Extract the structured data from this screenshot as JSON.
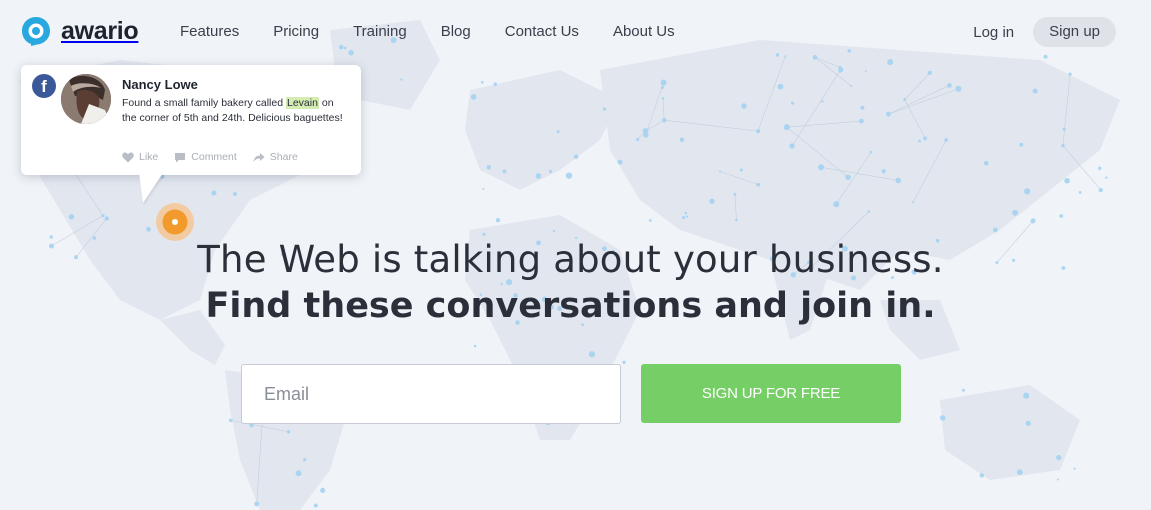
{
  "brand": {
    "name": "awario",
    "accent": "#29a8e0"
  },
  "nav": {
    "items": [
      {
        "label": "Features"
      },
      {
        "label": "Pricing"
      },
      {
        "label": "Training"
      },
      {
        "label": "Blog"
      },
      {
        "label": "Contact Us"
      },
      {
        "label": "About Us"
      }
    ],
    "login_label": "Log in",
    "signup_label": "Sign up"
  },
  "post_card": {
    "network_icon": "facebook-icon",
    "author": "Nancy Lowe",
    "text_before": "Found a small family bakery called ",
    "highlight": "Levain",
    "text_after": " on the corner of 5th and 24th. Delicious baguettes!",
    "actions": {
      "like": "Like",
      "comment": "Comment",
      "share": "Share"
    }
  },
  "hero": {
    "line1": "The Web is talking about your business.",
    "line2": "Find these conversations and join in."
  },
  "signup_form": {
    "email_placeholder": "Email",
    "email_value": "",
    "submit_label": "SIGN UP FOR FREE",
    "submit_color": "#76cf66"
  }
}
